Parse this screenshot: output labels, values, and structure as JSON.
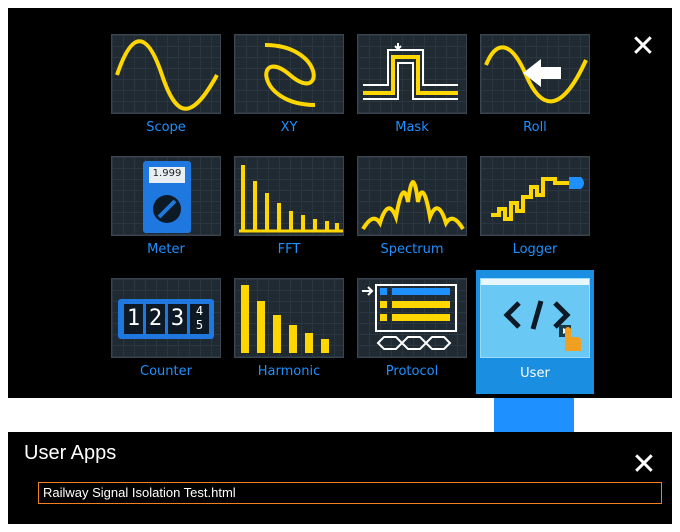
{
  "launcher": {
    "tiles": [
      {
        "label": "Scope",
        "icon": "sine-wave-icon"
      },
      {
        "label": "XY",
        "icon": "lissajous-icon"
      },
      {
        "label": "Mask",
        "icon": "mask-test-icon"
      },
      {
        "label": "Roll",
        "icon": "roll-arrow-icon"
      },
      {
        "label": "Meter",
        "icon": "multimeter-icon",
        "reading": "1.999"
      },
      {
        "label": "FFT",
        "icon": "fft-bars-icon"
      },
      {
        "label": "Spectrum",
        "icon": "spectrum-icon"
      },
      {
        "label": "Logger",
        "icon": "logger-icon"
      },
      {
        "label": "Counter",
        "icon": "counter-digits-icon",
        "digits": [
          "1",
          "2",
          "3"
        ],
        "roll_top": "4",
        "roll_bottom": "5"
      },
      {
        "label": "Harmonic",
        "icon": "harmonic-bars-icon"
      },
      {
        "label": "Protocol",
        "icon": "protocol-icon"
      },
      {
        "label": "User",
        "icon": "code-icon",
        "selected": true
      }
    ],
    "close_symbol": "✕"
  },
  "user_apps": {
    "title": "User Apps",
    "close_symbol": "✕",
    "files": [
      "Railway Signal Isolation Test.html"
    ]
  },
  "colors": {
    "accent": "#1e90ff",
    "trace": "#ffd700",
    "selection": "#1a8ee0",
    "file_border": "#f08020"
  }
}
